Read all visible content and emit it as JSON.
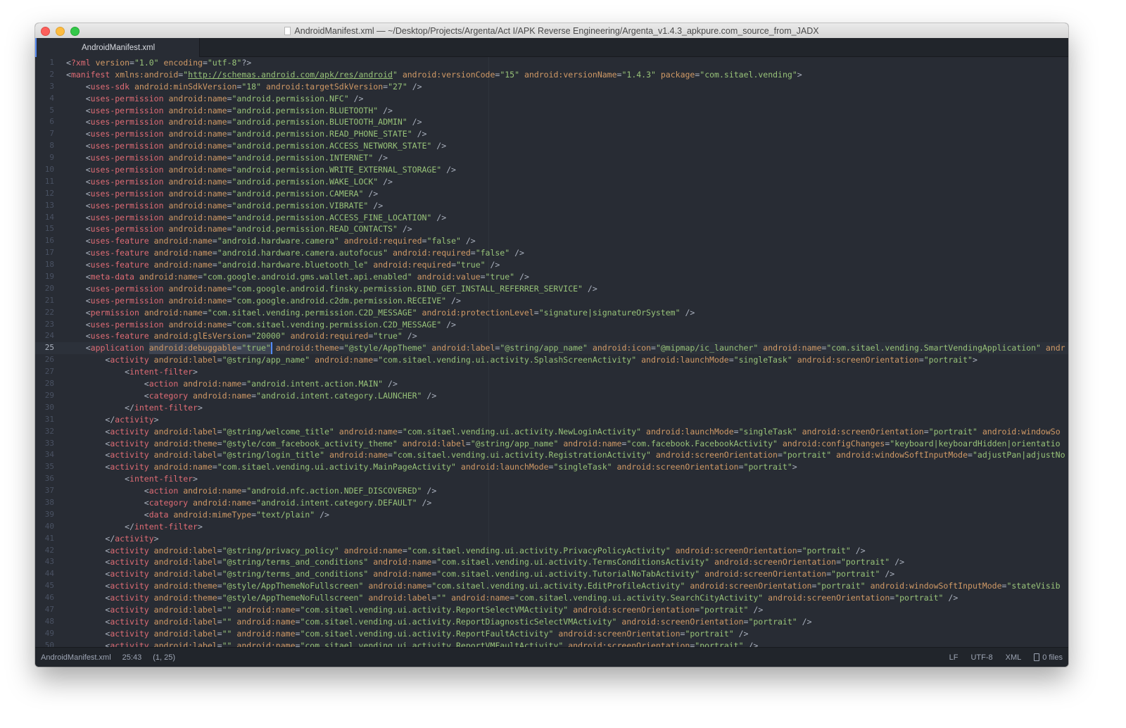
{
  "window": {
    "title": "AndroidManifest.xml — ~/Desktop/Projects/Argenta/Act I/APK Reverse Engineering/Argenta_v1.4.3_apkpure.com_source_from_JADX"
  },
  "tabs": [
    {
      "label": "AndroidManifest.xml",
      "active": true
    }
  ],
  "editor": {
    "cursor_line": 25,
    "selection_text": "android:debuggable=\"true\"",
    "lines": [
      "<?xml version=\"1.0\" encoding=\"utf-8\"?>",
      "<manifest xmlns:android=\"http://schemas.android.com/apk/res/android\" android:versionCode=\"15\" android:versionName=\"1.4.3\" package=\"com.sitael.vending\">",
      "    <uses-sdk android:minSdkVersion=\"18\" android:targetSdkVersion=\"27\" />",
      "    <uses-permission android:name=\"android.permission.NFC\" />",
      "    <uses-permission android:name=\"android.permission.BLUETOOTH\" />",
      "    <uses-permission android:name=\"android.permission.BLUETOOTH_ADMIN\" />",
      "    <uses-permission android:name=\"android.permission.READ_PHONE_STATE\" />",
      "    <uses-permission android:name=\"android.permission.ACCESS_NETWORK_STATE\" />",
      "    <uses-permission android:name=\"android.permission.INTERNET\" />",
      "    <uses-permission android:name=\"android.permission.WRITE_EXTERNAL_STORAGE\" />",
      "    <uses-permission android:name=\"android.permission.WAKE_LOCK\" />",
      "    <uses-permission android:name=\"android.permission.CAMERA\" />",
      "    <uses-permission android:name=\"android.permission.VIBRATE\" />",
      "    <uses-permission android:name=\"android.permission.ACCESS_FINE_LOCATION\" />",
      "    <uses-permission android:name=\"android.permission.READ_CONTACTS\" />",
      "    <uses-feature android:name=\"android.hardware.camera\" android:required=\"false\" />",
      "    <uses-feature android:name=\"android.hardware.camera.autofocus\" android:required=\"false\" />",
      "    <uses-feature android:name=\"android.hardware.bluetooth_le\" android:required=\"true\" />",
      "    <meta-data android:name=\"com.google.android.gms.wallet.api.enabled\" android:value=\"true\" />",
      "    <uses-permission android:name=\"com.google.android.finsky.permission.BIND_GET_INSTALL_REFERRER_SERVICE\" />",
      "    <uses-permission android:name=\"com.google.android.c2dm.permission.RECEIVE\" />",
      "    <permission android:name=\"com.sitael.vending.permission.C2D_MESSAGE\" android:protectionLevel=\"signature|signatureOrSystem\" />",
      "    <uses-permission android:name=\"com.sitael.vending.permission.C2D_MESSAGE\" />",
      "    <uses-feature android:glEsVersion=\"20000\" android:required=\"true\" />",
      "    <application android:debuggable=\"true\" android:theme=\"@style/AppTheme\" android:label=\"@string/app_name\" android:icon=\"@mipmap/ic_launcher\" android:name=\"com.sitael.vending.SmartVendingApplication\" andr",
      "        <activity android:label=\"@string/app_name\" android:name=\"com.sitael.vending.ui.activity.SplashScreenActivity\" android:launchMode=\"singleTask\" android:screenOrientation=\"portrait\">",
      "            <intent-filter>",
      "                <action android:name=\"android.intent.action.MAIN\" />",
      "                <category android:name=\"android.intent.category.LAUNCHER\" />",
      "            </intent-filter>",
      "        </activity>",
      "        <activity android:label=\"@string/welcome_title\" android:name=\"com.sitael.vending.ui.activity.NewLoginActivity\" android:launchMode=\"singleTask\" android:screenOrientation=\"portrait\" android:windowSo",
      "        <activity android:theme=\"@style/com_facebook_activity_theme\" android:label=\"@string/app_name\" android:name=\"com.facebook.FacebookActivity\" android:configChanges=\"keyboard|keyboardHidden|orientatio",
      "        <activity android:label=\"@string/login_title\" android:name=\"com.sitael.vending.ui.activity.RegistrationActivity\" android:screenOrientation=\"portrait\" android:windowSoftInputMode=\"adjustPan|adjustNo",
      "        <activity android:name=\"com.sitael.vending.ui.activity.MainPageActivity\" android:launchMode=\"singleTask\" android:screenOrientation=\"portrait\">",
      "            <intent-filter>",
      "                <action android:name=\"android.nfc.action.NDEF_DISCOVERED\" />",
      "                <category android:name=\"android.intent.category.DEFAULT\" />",
      "                <data android:mimeType=\"text/plain\" />",
      "            </intent-filter>",
      "        </activity>",
      "        <activity android:label=\"@string/privacy_policy\" android:name=\"com.sitael.vending.ui.activity.PrivacyPolicyActivity\" android:screenOrientation=\"portrait\" />",
      "        <activity android:label=\"@string/terms_and_conditions\" android:name=\"com.sitael.vending.ui.activity.TermsConditionsActivity\" android:screenOrientation=\"portrait\" />",
      "        <activity android:label=\"@string/terms_and_conditions\" android:name=\"com.sitael.vending.ui.activity.TutorialNoTabActivity\" android:screenOrientation=\"portrait\" />",
      "        <activity android:theme=\"@style/AppThemeNoFullscreen\" android:name=\"com.sitael.vending.ui.activity.EditProfileActivity\" android:screenOrientation=\"portrait\" android:windowSoftInputMode=\"stateVisib",
      "        <activity android:theme=\"@style/AppThemeNoFullscreen\" android:label=\"\" android:name=\"com.sitael.vending.ui.activity.SearchCityActivity\" android:screenOrientation=\"portrait\" />",
      "        <activity android:label=\"\" android:name=\"com.sitael.vending.ui.activity.ReportSelectVMActivity\" android:screenOrientation=\"portrait\" />",
      "        <activity android:label=\"\" android:name=\"com.sitael.vending.ui.activity.ReportDiagnosticSelectVMActivity\" android:screenOrientation=\"portrait\" />",
      "        <activity android:label=\"\" android:name=\"com.sitael.vending.ui.activity.ReportFaultActivity\" android:screenOrientation=\"portrait\" />",
      "        <activity android:label=\"\" android:name=\"com.sitael.vending.ui.activity.ReportVMFaultActivity\" android:screenOrientation=\"portrait\" />"
    ]
  },
  "statusbar": {
    "file": "AndroidManifest.xml",
    "cursor_position": "25:43",
    "selection": "(1, 25)",
    "line_ending": "LF",
    "encoding": "UTF-8",
    "grammar": "XML",
    "git_files": "0 files"
  }
}
